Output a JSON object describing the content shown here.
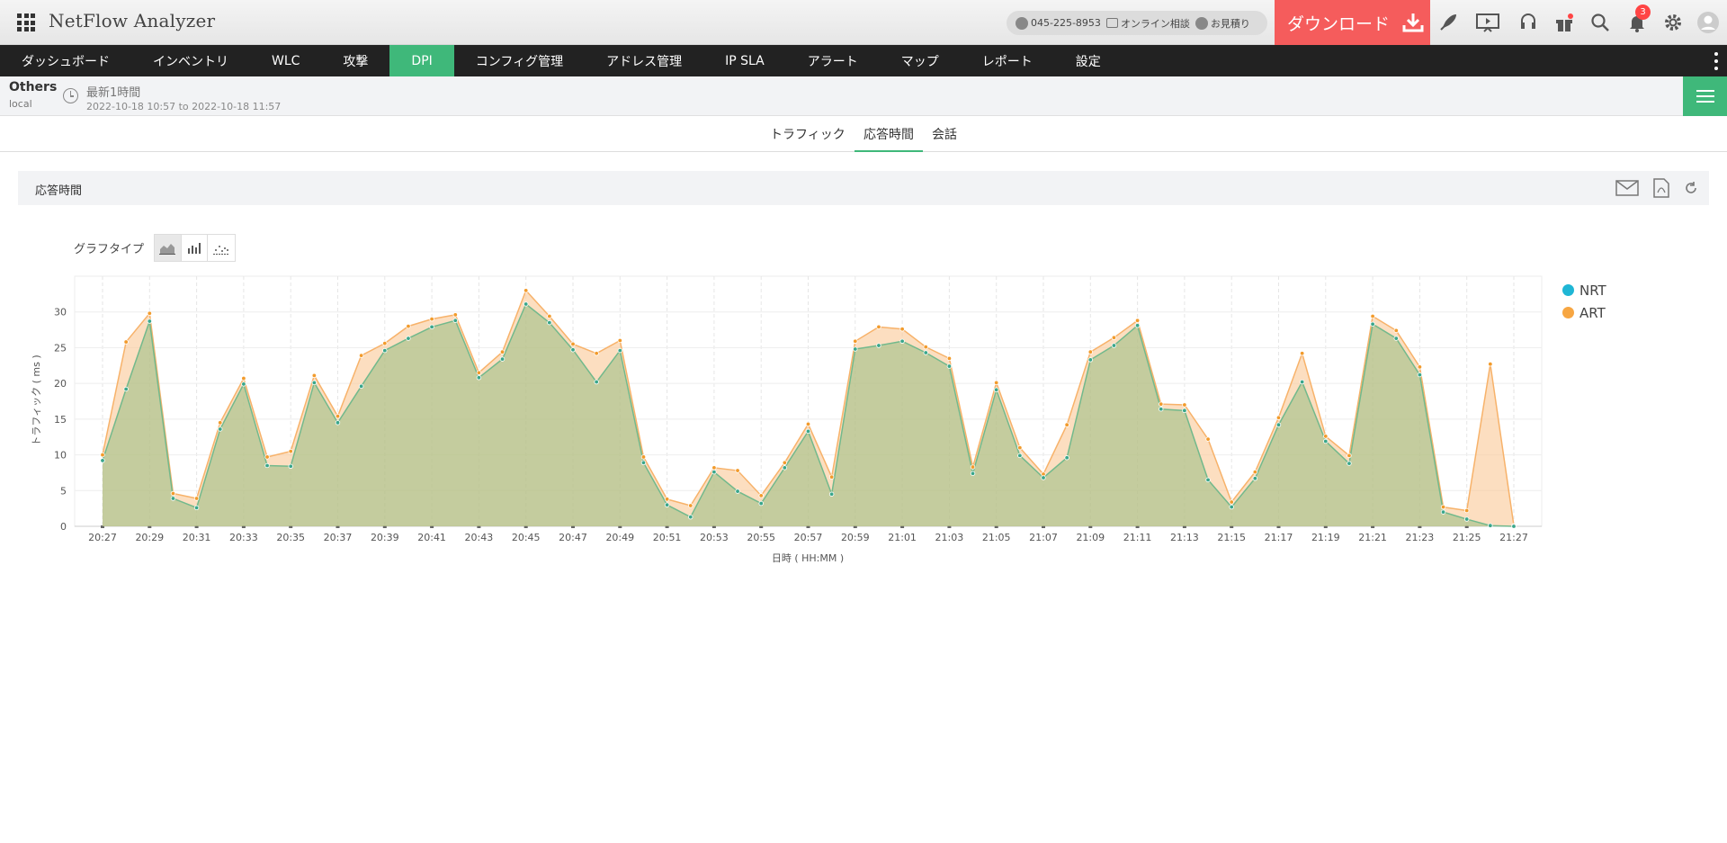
{
  "app": {
    "title": "NetFlow Analyzer"
  },
  "header": {
    "phone": "045-225-8953",
    "online_consult": "オンライン相談",
    "quote": "お見積り",
    "download_label": "ダウンロード",
    "notification_count": "3"
  },
  "nav": {
    "items": [
      "ダッシュボード",
      "インベントリ",
      "WLC",
      "攻撃",
      "DPI",
      "コンフィグ管理",
      "アドレス管理",
      "IP SLA",
      "アラート",
      "マップ",
      "レポート",
      "設定"
    ],
    "active": "DPI"
  },
  "context": {
    "device": "Others",
    "sub": "local",
    "period": "最新1時間",
    "range": "2022-10-18 10:57 to 2022-10-18 11:57"
  },
  "tabs": {
    "items": [
      "トラフィック",
      "応答時間",
      "会話"
    ],
    "active": "応答時間"
  },
  "panel": {
    "title": "応答時間",
    "graph_type_label": "グラフタイプ"
  },
  "colors": {
    "accent": "#3fb87a",
    "download": "#f55c5c",
    "nrt": "#1fb6d5",
    "art": "#f7a642"
  },
  "chart_data": {
    "type": "area",
    "xlabel": "日時 ( HH:MM )",
    "ylabel": "トラフィック ( ms )",
    "ylim": [
      0,
      35
    ],
    "yticks": [
      0,
      5,
      10,
      15,
      20,
      25,
      30
    ],
    "grid": true,
    "legend_position": "right",
    "x_tick_labels": [
      "20:27",
      "20:29",
      "20:31",
      "20:33",
      "20:35",
      "20:37",
      "20:39",
      "20:41",
      "20:43",
      "20:45",
      "20:47",
      "20:49",
      "20:51",
      "20:53",
      "20:55",
      "20:57",
      "20:59",
      "21:01",
      "21:03",
      "21:05",
      "21:07",
      "21:09",
      "21:11",
      "21:13",
      "21:15",
      "21:17",
      "21:19",
      "21:21",
      "21:23",
      "21:25",
      "21:27"
    ],
    "series": [
      {
        "name": "NRT",
        "values": [
          9.2,
          19.2,
          28.7,
          3.9,
          2.6,
          13.6,
          19.9,
          8.5,
          8.4,
          20.1,
          14.5,
          19.6,
          24.6,
          26.3,
          27.9,
          28.8,
          20.8,
          23.4,
          31.1,
          28.5,
          24.7,
          20.2,
          24.6,
          8.9,
          3.0,
          1.3,
          7.6,
          4.9,
          3.2,
          8.2,
          13.3,
          4.5,
          24.8,
          25.3,
          25.9,
          24.3,
          22.4,
          7.4,
          19.1,
          9.9,
          6.8,
          9.6,
          23.3,
          25.3,
          28.1,
          16.4,
          16.2,
          6.5,
          2.7,
          6.7,
          14.2,
          20.2,
          11.9,
          8.8,
          28.3,
          26.3,
          21.2,
          2.0,
          1.0,
          0.1,
          0
        ]
      },
      {
        "name": "ART",
        "values": [
          10.0,
          25.8,
          29.8,
          4.6,
          3.9,
          14.5,
          20.7,
          9.7,
          10.5,
          21.1,
          15.4,
          23.9,
          25.6,
          28.0,
          29.0,
          29.6,
          21.5,
          24.4,
          33.0,
          29.4,
          25.5,
          24.2,
          26.0,
          9.7,
          3.8,
          2.9,
          8.2,
          7.8,
          4.3,
          8.9,
          14.3,
          6.9,
          25.9,
          27.9,
          27.6,
          25.1,
          23.5,
          8.3,
          20.1,
          11.0,
          7.3,
          14.2,
          24.4,
          26.4,
          28.8,
          17.1,
          17.0,
          12.2,
          3.4,
          7.6,
          15.2,
          24.2,
          12.6,
          9.9,
          29.4,
          27.4,
          22.3,
          2.7,
          2.2,
          22.7,
          0.1
        ]
      }
    ]
  }
}
